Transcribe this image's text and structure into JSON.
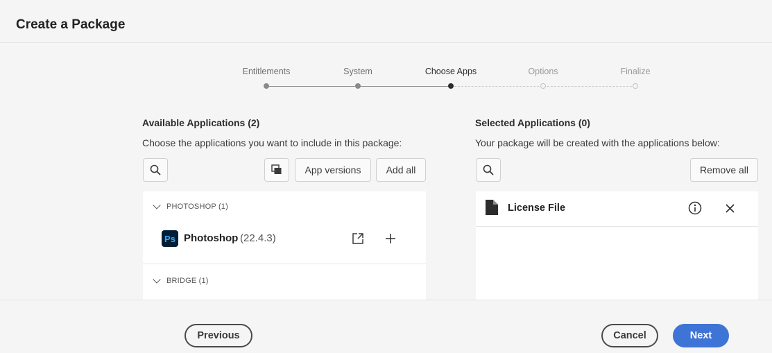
{
  "header": {
    "title": "Create a Package"
  },
  "stepper": {
    "steps": [
      {
        "label": "Entitlements",
        "state": "done"
      },
      {
        "label": "System",
        "state": "done"
      },
      {
        "label": "Choose Apps",
        "state": "current"
      },
      {
        "label": "Options",
        "state": "todo"
      },
      {
        "label": "Finalize",
        "state": "todo"
      }
    ]
  },
  "available": {
    "heading": "Available Applications (2)",
    "description": "Choose the applications you want to include in this package:",
    "app_versions_label": "App versions",
    "add_all_label": "Add all",
    "groups": [
      {
        "name": "PHOTOSHOP (1)",
        "apps": [
          {
            "icon_text": "Ps",
            "name": "Photoshop",
            "version": "(22.4.3)"
          }
        ]
      },
      {
        "name": "BRIDGE (1)",
        "apps": []
      }
    ]
  },
  "selected": {
    "heading": "Selected Applications (0)",
    "description": "Your package will be created with the applications below:",
    "remove_all_label": "Remove all",
    "items": [
      {
        "name": "License File"
      }
    ]
  },
  "footer": {
    "previous_label": "Previous",
    "cancel_label": "Cancel",
    "next_label": "Next"
  },
  "colors": {
    "accent": "#3e74d6",
    "photoshop_bg": "#001e36",
    "photoshop_fg": "#31a8ff"
  }
}
